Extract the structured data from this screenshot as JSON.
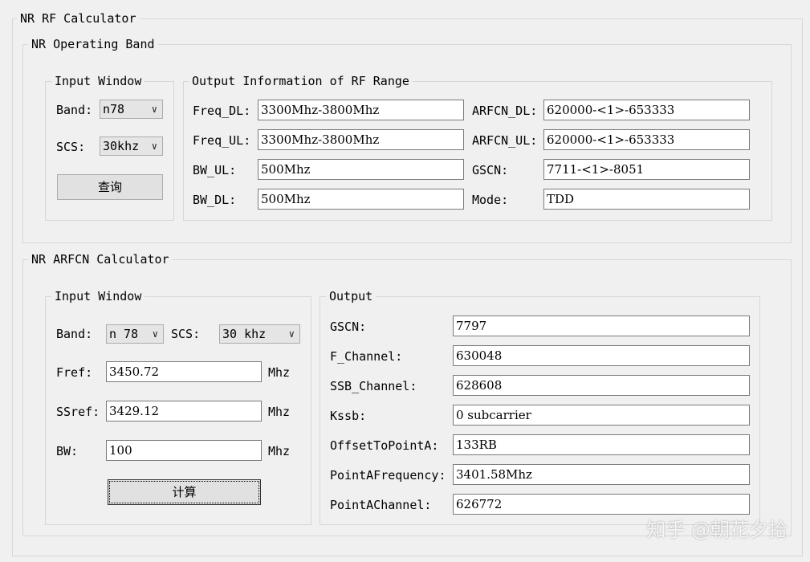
{
  "app": {
    "title": "NR RF Calculator"
  },
  "operating_band": {
    "title": "NR Operating Band",
    "input": {
      "title": "Input Window",
      "band_label": "Band:",
      "band_value": "n78",
      "scs_label": "SCS:",
      "scs_value": "30khz",
      "query_button": "查询"
    },
    "output": {
      "title": "Output Information of RF Range",
      "freq_dl_label": "Freq_DL:",
      "freq_dl_value": "3300Mhz-3800Mhz",
      "freq_ul_label": "Freq_UL:",
      "freq_ul_value": "3300Mhz-3800Mhz",
      "bw_ul_label": "BW_UL:",
      "bw_ul_value": "500Mhz",
      "bw_dl_label": "BW_DL:",
      "bw_dl_value": "500Mhz",
      "arfcn_dl_label": "ARFCN_DL:",
      "arfcn_dl_value": "620000-<1>-653333",
      "arfcn_ul_label": "ARFCN_UL:",
      "arfcn_ul_value": "620000-<1>-653333",
      "gscn_label": "GSCN:",
      "gscn_value": "7711-<1>-8051",
      "mode_label": "Mode:",
      "mode_value": "TDD"
    }
  },
  "arfcn_calc": {
    "title": "NR ARFCN Calculator",
    "input": {
      "title": "Input Window",
      "band_label": "Band:",
      "band_value": "n 78",
      "scs_label": "SCS:",
      "scs_value": "30 khz",
      "fref_label": "Fref:",
      "fref_value": "3450.72",
      "ssref_label": "SSref:",
      "ssref_value": "3429.12",
      "bw_label": "BW:",
      "bw_value": "100",
      "unit": "Mhz",
      "calc_button": "计算"
    },
    "output": {
      "title": "Output",
      "rows": [
        {
          "label": "GSCN:",
          "value": "7797"
        },
        {
          "label": "F_Channel:",
          "value": "630048"
        },
        {
          "label": "SSB_Channel:",
          "value": "628608"
        },
        {
          "label": "Kssb:",
          "value": "0 subcarrier"
        },
        {
          "label": "OffsetToPointA:",
          "value": "133RB"
        },
        {
          "label": "PointAFrequency:",
          "value": "3401.58Mhz"
        },
        {
          "label": "PointAChannel:",
          "value": "626772"
        }
      ]
    }
  },
  "watermark": "知乎 @朝花夕拾"
}
